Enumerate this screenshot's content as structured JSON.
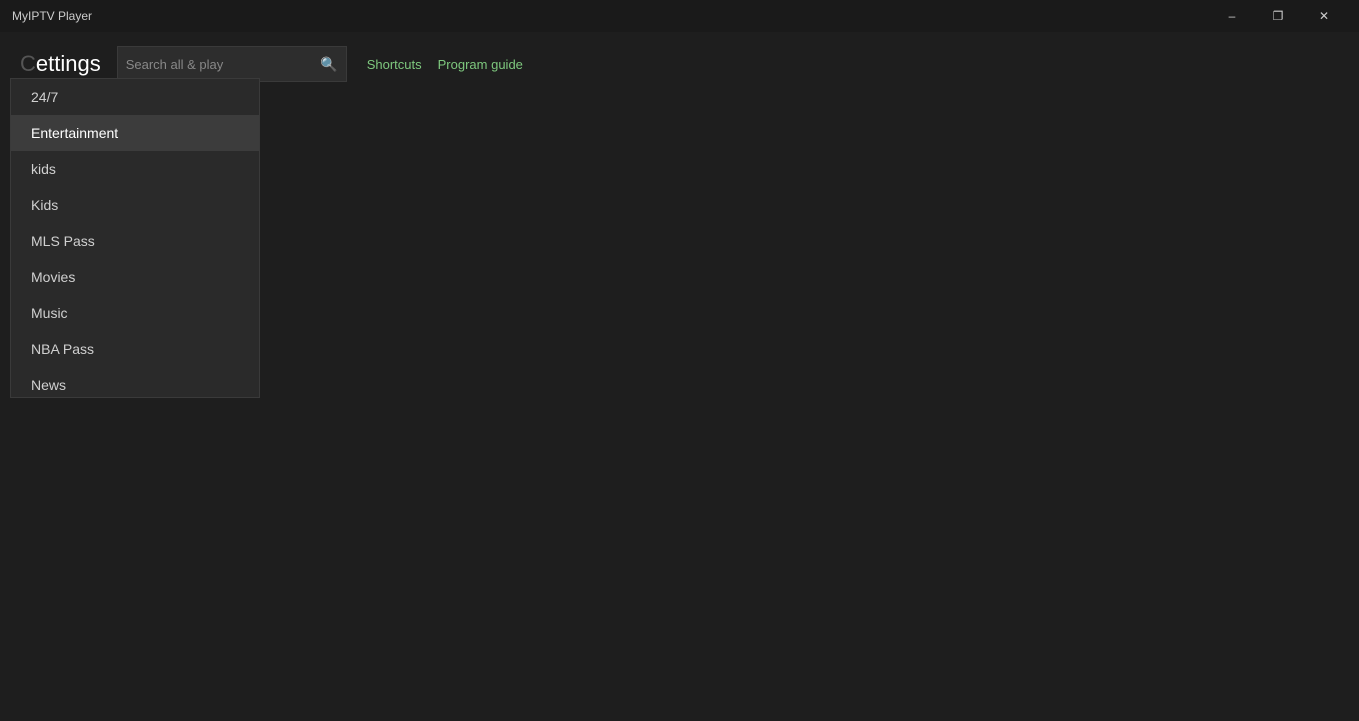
{
  "app": {
    "title": "MyIPTV Player"
  },
  "titlebar": {
    "minimize_label": "–",
    "maximize_label": "❐",
    "close_label": "✕"
  },
  "header": {
    "page_title": "ettings",
    "search_placeholder": "Search all & play",
    "shortcuts_label": "Shortcuts",
    "program_guide_label": "Program guide"
  },
  "dropdown": {
    "items": [
      {
        "label": "24/7",
        "active": false
      },
      {
        "label": "Entertainment",
        "active": true
      },
      {
        "label": "kids",
        "active": false
      },
      {
        "label": "Kids",
        "active": false
      },
      {
        "label": "MLS Pass",
        "active": false
      },
      {
        "label": "Movies",
        "active": false
      },
      {
        "label": "Music",
        "active": false
      },
      {
        "label": "NBA Pass",
        "active": false
      },
      {
        "label": "News",
        "active": false
      }
    ]
  }
}
